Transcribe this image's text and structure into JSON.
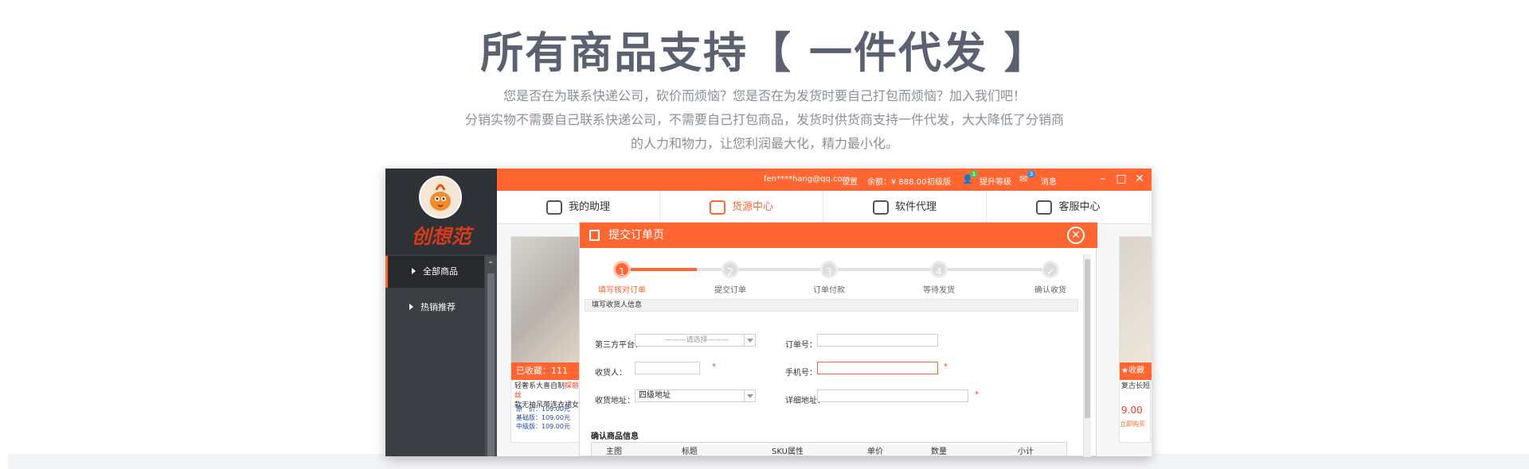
{
  "hero": {
    "title": "所有商品支持【 一件代发 】",
    "line1": "您是否在为联系快递公司，砍价而烦恼？您是否在为发货时要自己打包而烦恼？加入我们吧！",
    "line2": "分销实物不需要自己联系快递公司，不需要自己打包商品，发货时供货商支持一件代发，大大降低了分销商",
    "line3": "的人力和物力，让您利润最大化，精力最小化。"
  },
  "app": {
    "logo_text": "创想范",
    "topbar": {
      "email": "fen****hang@qq.com",
      "settings": "设置",
      "balance": "余额：¥ 888.00",
      "level": "初级版",
      "upgrade_badge": "1",
      "upgrade": "提升等级",
      "message_badge": "3",
      "messages": "消息"
    },
    "nav": [
      {
        "label": "我的助理"
      },
      {
        "label": "货源中心"
      },
      {
        "label": "软件代理"
      },
      {
        "label": "客服中心"
      }
    ],
    "sidebar": [
      {
        "label": "全部商品"
      },
      {
        "label": "热销推荐"
      }
    ],
    "left_card": {
      "collect": "已收藏：111",
      "title1": "轻奢系大喜自制",
      "title1_hl": "探丽丝",
      "title2": "款无袖吊带连衣裙女",
      "p1": "原　价：109.00元",
      "p2": "基础版：109.00元",
      "p3": "中级版：109.00元"
    },
    "right_card": {
      "collect": "收藏",
      "title": "复古长短",
      "price": "9.00",
      "buy": "立即购买"
    }
  },
  "modal": {
    "title": "提交订单页",
    "steps": [
      {
        "num": "1",
        "label": "填写核对订单"
      },
      {
        "num": "2",
        "label": "提交订单"
      },
      {
        "num": "3",
        "label": "订单付款"
      },
      {
        "num": "4",
        "label": "等待发货"
      },
      {
        "num": "✓",
        "label": "确认收货"
      }
    ],
    "section": "填写收货人信息",
    "form": {
      "platform_label": "第三方平台：",
      "platform_placeholder": "———请选择———",
      "order_label": "订单号：",
      "receiver_label": "收货人：",
      "phone_label": "手机号：",
      "address_label": "收货地址：",
      "address_value": "四级地址",
      "detail_label": "详细地址：",
      "required": "*"
    },
    "confirm_title": "确认商品信息",
    "table_headers": [
      "主图",
      "标题",
      "SKU属性",
      "单价",
      "数量",
      "小计"
    ]
  }
}
